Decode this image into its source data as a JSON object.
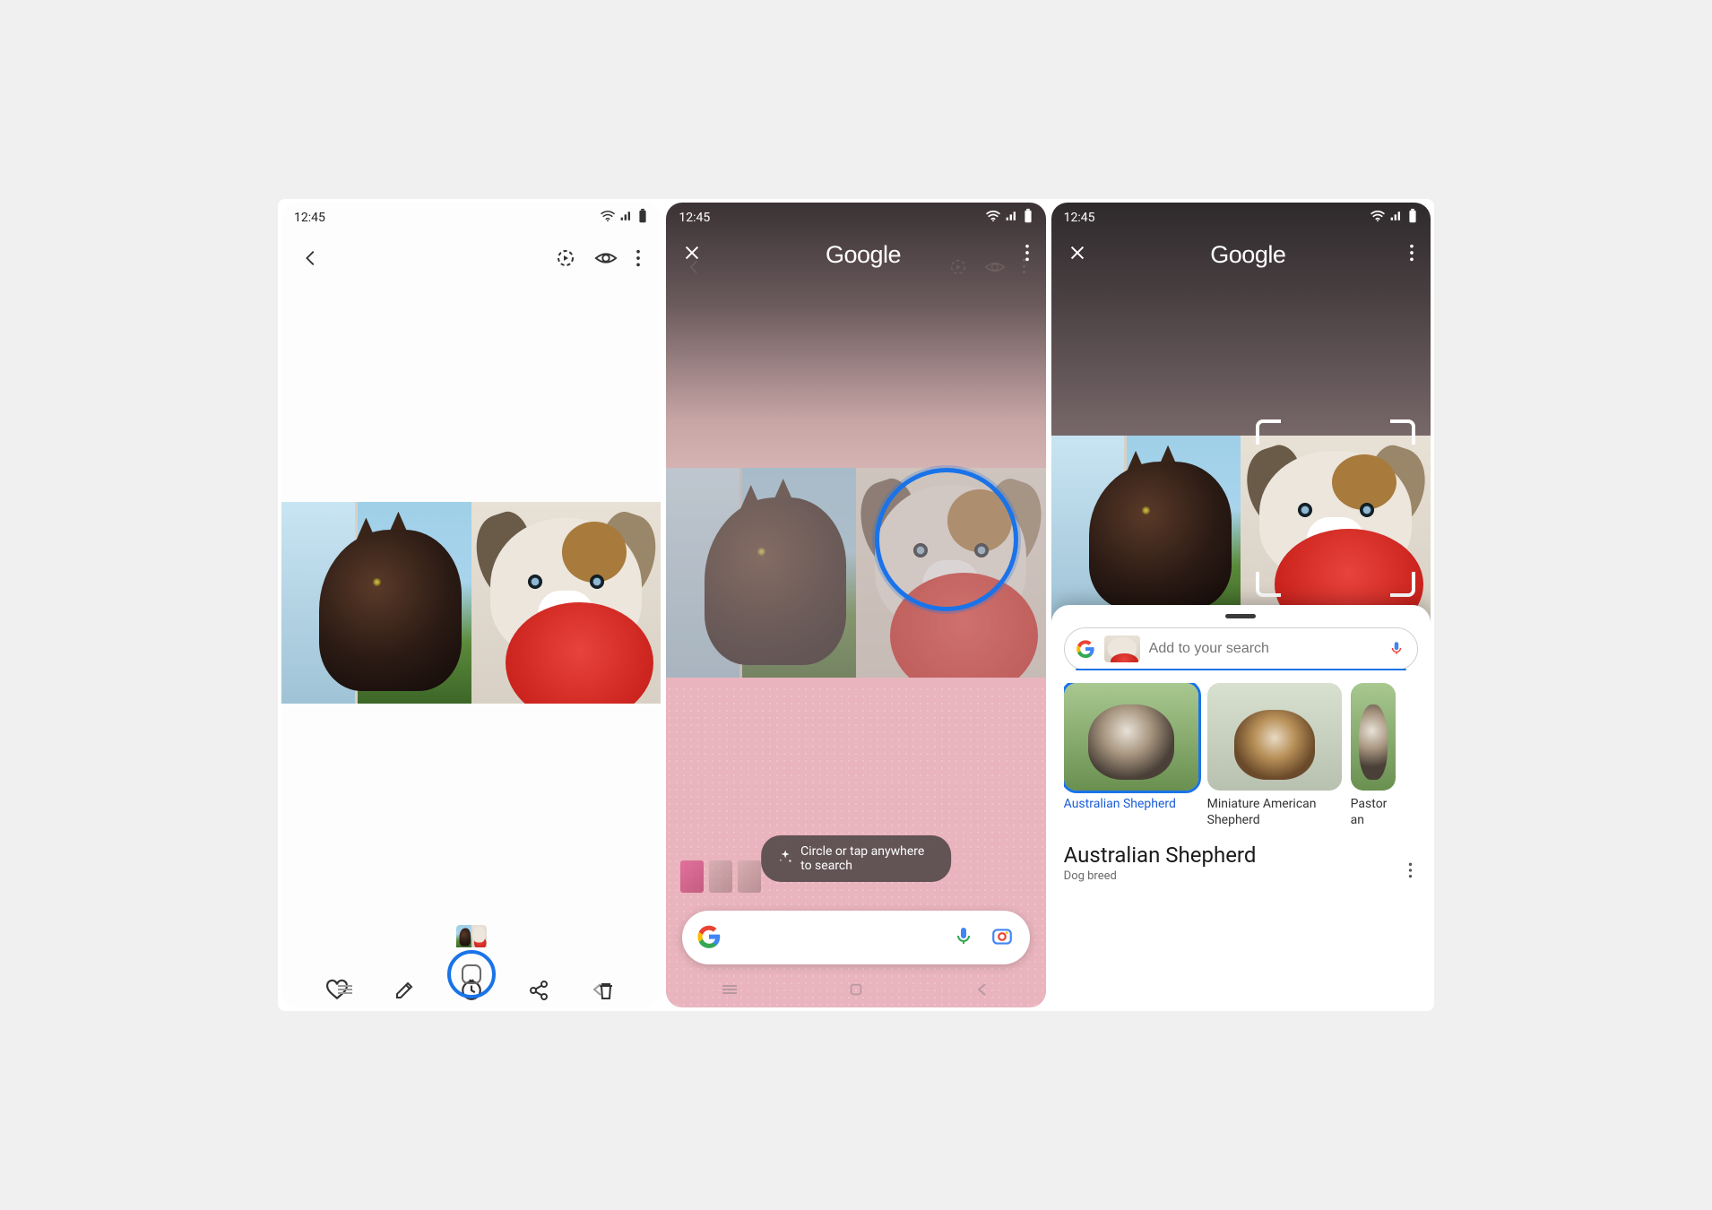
{
  "status": {
    "time": "12:45"
  },
  "panel1": {
    "actions": [
      "heart",
      "edit",
      "motion",
      "share",
      "trash"
    ]
  },
  "panel2": {
    "brand": "Google",
    "hint": "Circle or tap anywhere to search"
  },
  "panel3": {
    "brand": "Google",
    "search_placeholder": "Add to your search",
    "results": [
      {
        "label": "Australian Shepherd",
        "selected": true
      },
      {
        "label": "Miniature American Shepherd",
        "selected": false
      },
      {
        "label": "Pastor an",
        "selected": false
      }
    ],
    "topic": {
      "title": "Australian Shepherd",
      "subtitle": "Dog breed"
    }
  }
}
